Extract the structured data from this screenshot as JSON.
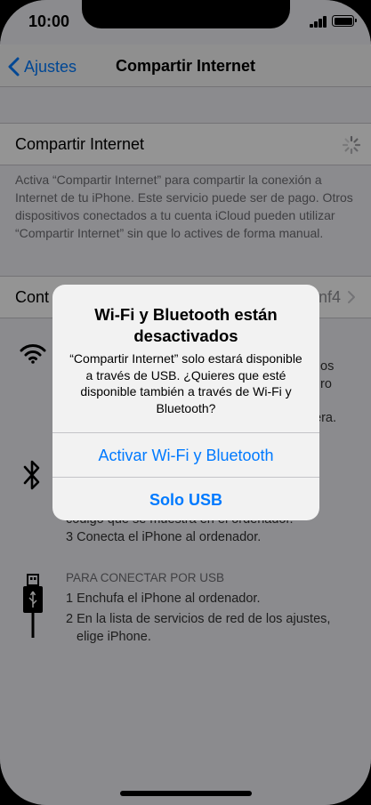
{
  "status_bar": {
    "time": "10:00"
  },
  "nav": {
    "back_label": "Ajustes",
    "title": "Compartir Internet"
  },
  "hotspot_cell": {
    "label": "Compartir Internet"
  },
  "footnote": "Activa “Compartir Internet” para compartir la conexión a Internet de tu iPhone. Este servicio puede ser de pago. Otros dispositivos conectados a tu cuenta iCloud pueden utilizar “Compartir Internet” sin que lo actives de forma manual.",
  "password_cell": {
    "label_visible": "Cont",
    "value_visible": "nf4"
  },
  "wifi_section": {
    "line1_tail": "os",
    "line2_tail": "ro",
    "line3_tail": "era."
  },
  "bluetooth_section": {
    "partial_line": "código que se muestra en el ordenador.",
    "step3": "3 Conecta el iPhone al ordenador."
  },
  "usb_section": {
    "heading": "PARA CONECTAR POR USB",
    "step1": "1 Enchufa el iPhone al ordenador.",
    "step2_line1": "2 En la lista de servicios de red de los ajustes,",
    "step2_line2": "elige iPhone."
  },
  "alert": {
    "title": "Wi-Fi y Bluetooth están desactivados",
    "message": "“Compartir Internet” solo estará disponible a través de USB. ¿Quieres que esté disponible también a través de Wi-Fi y Bluetooth?",
    "primary_button": "Activar Wi-Fi y Bluetooth",
    "secondary_button": "Solo USB"
  },
  "colors": {
    "accent": "#007aff",
    "background": "#efeff4",
    "secondary_text": "#6d6d72"
  }
}
